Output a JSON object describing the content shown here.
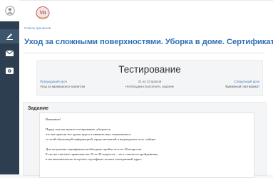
{
  "sidebar": {
    "items": [
      {
        "icon": "user-icon"
      },
      {
        "icon": "course-edit-icon"
      },
      {
        "icon": "mail-icon"
      },
      {
        "icon": "certificate-icon"
      }
    ]
  },
  "breadcrumb": "Список тренингов",
  "page_title": "Уход за сложными поверхностями. Уборка в доме. Сертификат",
  "test": {
    "heading": "Тестирование",
    "prev_label": "Предыдущий урок",
    "prev_name": "Уход за мрамором и гранитом",
    "count": "21 из 23 уроков",
    "note": "Необходимо выполнить задание",
    "next_label": "Следующий урок",
    "next_name": "Бумажный сертификат"
  },
  "task": {
    "label": "Задание",
    "lines": [
      "Внимание!",
      "Перед тем как начать тестирование, убедитесь,",
      "что вы прошли все уроки курса и внимательно ознакомились",
      "со всей обучающей информацией, представленной в видеоуроках и на слайдах.",
      "Для получения сертификата необходимо пройти тест из 30 вопросов.",
      "Если вы ответите правильно на 25 из 30 вопросов – тест считается пройденным,",
      "и вы автоматически получите сертификат на ваш электронный адрес."
    ]
  },
  "colors": {
    "sidebar": "#2c3e50",
    "title": "#2e6fb4",
    "link": "#4a82c3"
  }
}
